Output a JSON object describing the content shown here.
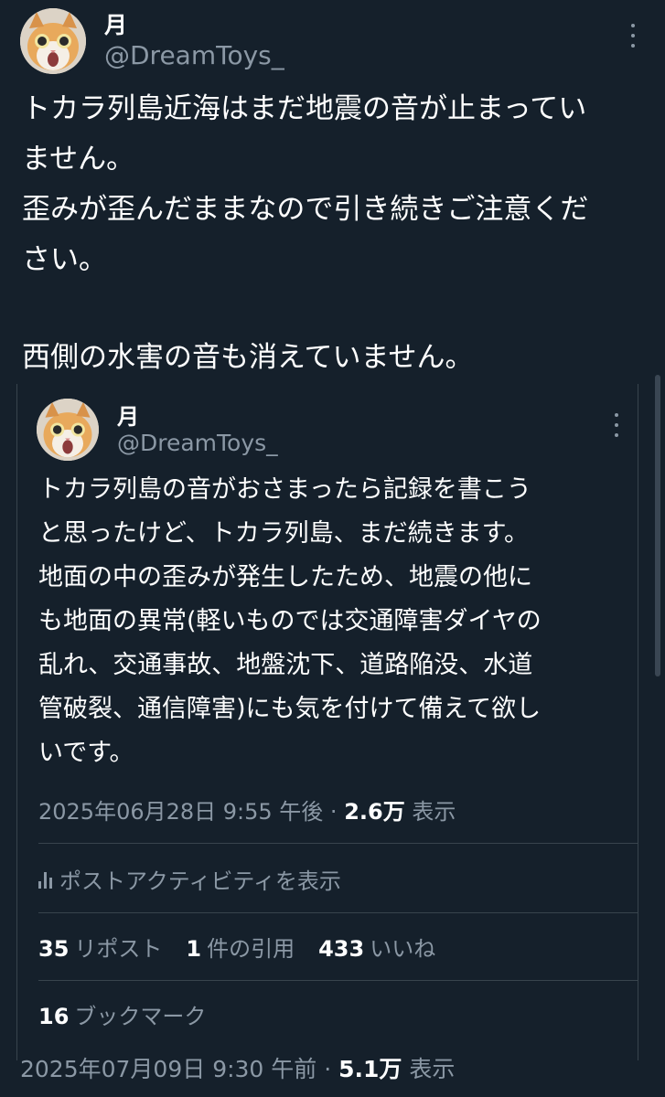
{
  "outer_tweet": {
    "display_name": "月",
    "handle": "@DreamToys_",
    "lines": [
      "トカラ列島近海はまだ地震の音が止まってい",
      "ません。",
      "歪みが歪んだままなので引き続きご注意くだ",
      "さい。",
      "",
      "西側の水害の音も消えていません。"
    ],
    "timestamp": "2025年07月09日 9:30 午前 · ",
    "views_count": "5.1万",
    "views_label": " 表示"
  },
  "quoted_tweet": {
    "display_name": "月",
    "handle": "@DreamToys_",
    "lines": [
      "トカラ列島の音がおさまったら記録を書こう",
      "と思ったけど、トカラ列島、まだ続きます。",
      "地面の中の歪みが発生したため、地震の他に",
      "も地面の異常(軽いものでは交通障害ダイヤの",
      "乱れ、交通事故、地盤沈下、道路陥没、水道",
      "管破裂、通信障害)にも気を付けて備えて欲し",
      "いです。"
    ],
    "timestamp": "2025年06月28日 9:55 午後 · ",
    "views_count": "2.6万",
    "views_label": " 表示",
    "activity_label": "ポストアクティビティを表示",
    "stats": {
      "reposts_count": "35",
      "reposts_label": "リポスト",
      "quotes_count": "1",
      "quotes_label": "件の引用",
      "likes_count": "433",
      "likes_label": "いいね",
      "bookmarks_count": "16",
      "bookmarks_label": "ブックマーク"
    }
  },
  "icons": {
    "more": "more-options-icon",
    "activity": "activity-chart-icon"
  },
  "colors": {
    "background": "#15202b",
    "primary_text": "#ffffff",
    "secondary_text": "#8b98a5",
    "border": "#38444d"
  }
}
